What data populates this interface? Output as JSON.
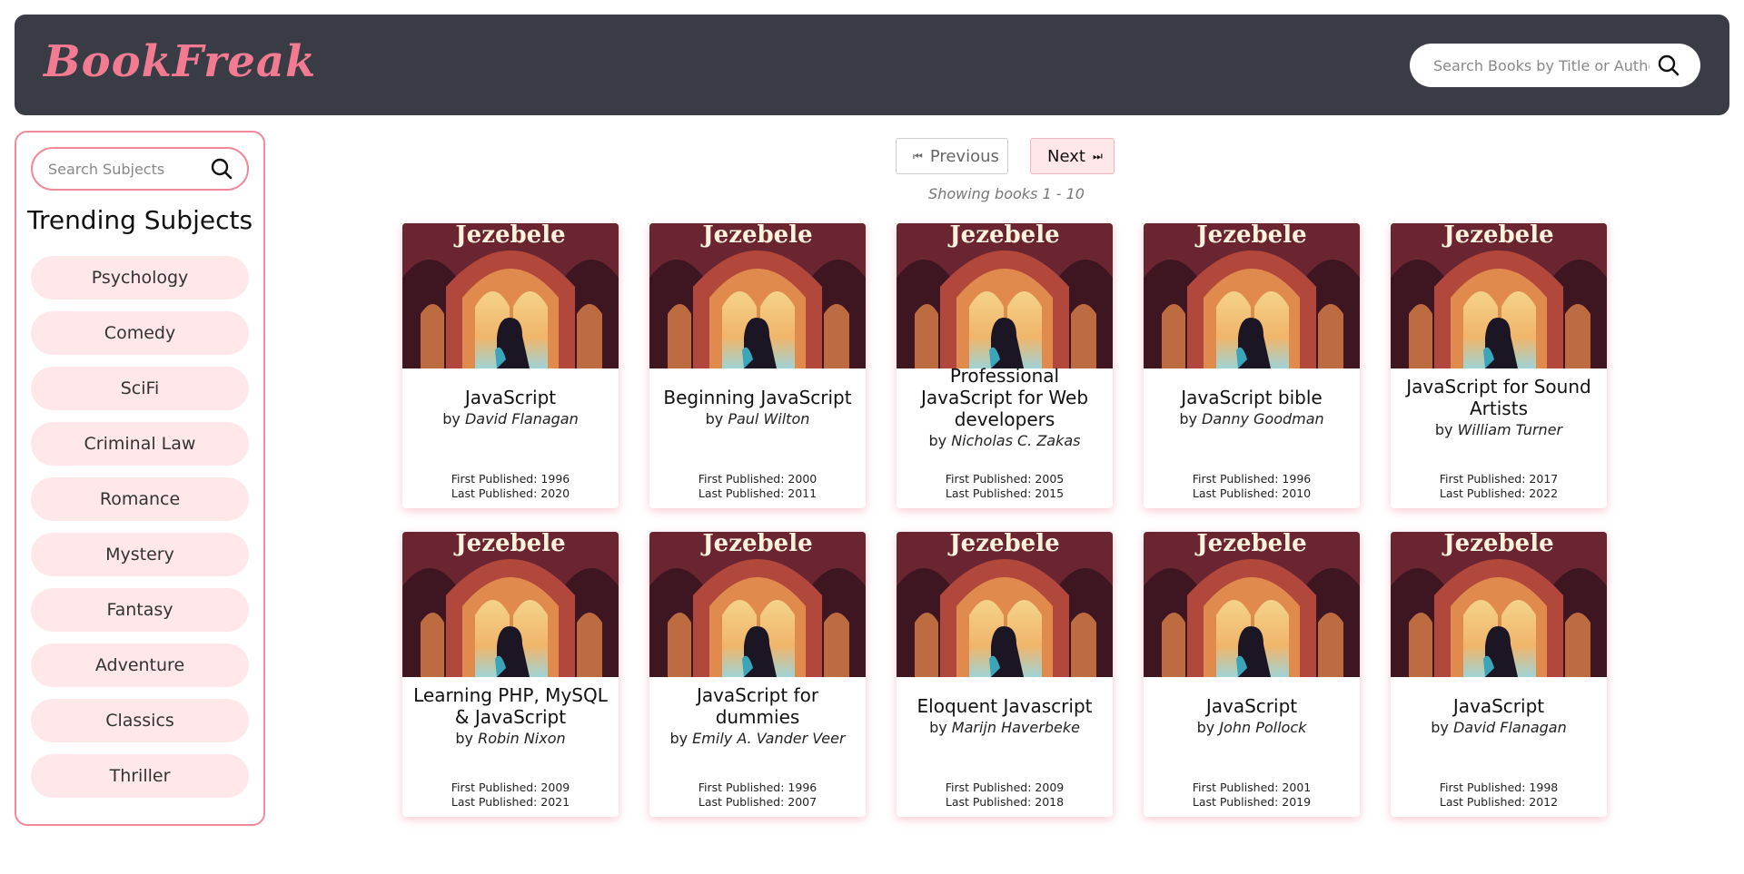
{
  "header": {
    "logo": "BookFreak",
    "search_placeholder": "Search Books by Title or Author",
    "search_icon": "search-icon"
  },
  "sidebar": {
    "search_placeholder": "Search Subjects",
    "title": "Trending Subjects",
    "subjects": [
      "Psychology",
      "Comedy",
      "SciFi",
      "Criminal Law",
      "Romance",
      "Mystery",
      "Fantasy",
      "Adventure",
      "Classics",
      "Thriller"
    ]
  },
  "pagination": {
    "prev_label": "Previous",
    "next_label": "Next",
    "showing": "Showing books 1 - 10"
  },
  "cover_text": "Jezebele",
  "colors": {
    "header_bg": "#393c45",
    "brand": "#f27b92",
    "pill_bg": "#ffe7ea",
    "border": "#f2899b"
  },
  "books": [
    {
      "title": "JavaScript",
      "by": "by",
      "author": "David Flanagan",
      "first": "First Published: 1996",
      "last": "Last Published: 2020"
    },
    {
      "title": "Beginning JavaScript",
      "by": "by",
      "author": "Paul Wilton",
      "first": "First Published: 2000",
      "last": "Last Published: 2011"
    },
    {
      "title": "Professional JavaScript for Web developers",
      "by": "by",
      "author": "Nicholas C. Zakas",
      "first": "First Published: 2005",
      "last": "Last Published: 2015"
    },
    {
      "title": "JavaScript bible",
      "by": "by",
      "author": "Danny Goodman",
      "first": "First Published: 1996",
      "last": "Last Published: 2010"
    },
    {
      "title": "JavaScript for Sound Artists",
      "by": "by",
      "author": "William Turner",
      "first": "First Published: 2017",
      "last": "Last Published: 2022"
    },
    {
      "title": "Learning PHP, MySQL & JavaScript",
      "by": "by",
      "author": "Robin Nixon",
      "first": "First Published: 2009",
      "last": "Last Published: 2021"
    },
    {
      "title": "JavaScript for dummies",
      "by": "by",
      "author": "Emily A. Vander Veer",
      "first": "First Published: 1996",
      "last": "Last Published: 2007"
    },
    {
      "title": "Eloquent Javascript",
      "by": "by",
      "author": "Marijn Haverbeke",
      "first": "First Published: 2009",
      "last": "Last Published: 2018"
    },
    {
      "title": "JavaScript",
      "by": "by",
      "author": "John Pollock",
      "first": "First Published: 2001",
      "last": "Last Published: 2019"
    },
    {
      "title": "JavaScript",
      "by": "by",
      "author": "David Flanagan",
      "first": "First Published: 1998",
      "last": "Last Published: 2012"
    }
  ]
}
